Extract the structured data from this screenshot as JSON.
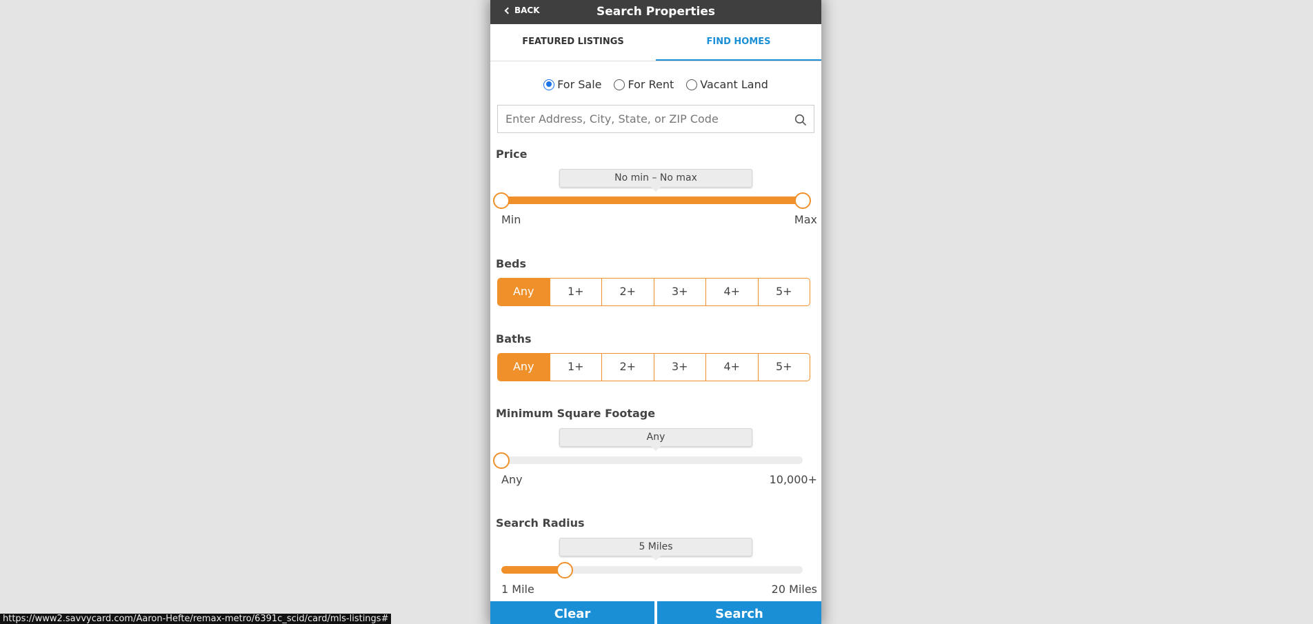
{
  "header": {
    "back_label": "BACK",
    "title": "Search Properties"
  },
  "tabs": [
    {
      "label": "FEATURED LISTINGS",
      "active": false
    },
    {
      "label": "FIND HOMES",
      "active": true
    }
  ],
  "listing_types": [
    {
      "label": "For Sale",
      "checked": true
    },
    {
      "label": "For Rent",
      "checked": false
    },
    {
      "label": "Vacant Land",
      "checked": false
    }
  ],
  "search": {
    "placeholder": "Enter Address, City, State, or ZIP Code",
    "value": ""
  },
  "price": {
    "title": "Price",
    "bubble": "No min – No max",
    "min_label": "Min",
    "max_label": "Max",
    "low_fraction": 0.0,
    "high_fraction": 1.0
  },
  "beds": {
    "title": "Beds",
    "options": [
      "Any",
      "1+",
      "2+",
      "3+",
      "4+",
      "5+"
    ],
    "selected": "Any"
  },
  "baths": {
    "title": "Baths",
    "options": [
      "Any",
      "1+",
      "2+",
      "3+",
      "4+",
      "5+"
    ],
    "selected": "Any"
  },
  "sqft": {
    "title": "Minimum Square Footage",
    "bubble": "Any",
    "min_label": "Any",
    "max_label": "10,000+",
    "fraction": 0.0
  },
  "radius": {
    "title": "Search Radius",
    "bubble": "5 Miles",
    "min_label": "1 Mile",
    "max_label": "20 Miles",
    "fraction": 0.21
  },
  "actions": {
    "clear_label": "Clear",
    "search_label": "Search"
  },
  "status_url": "https://www2.savvycard.com/Aaron-Hefte/remax-metro/6391c_scid/card/mls-listings#",
  "colors": {
    "accent_orange": "#f0902a",
    "accent_blue": "#1a8fd6",
    "header_bg": "#3f3f3f"
  }
}
